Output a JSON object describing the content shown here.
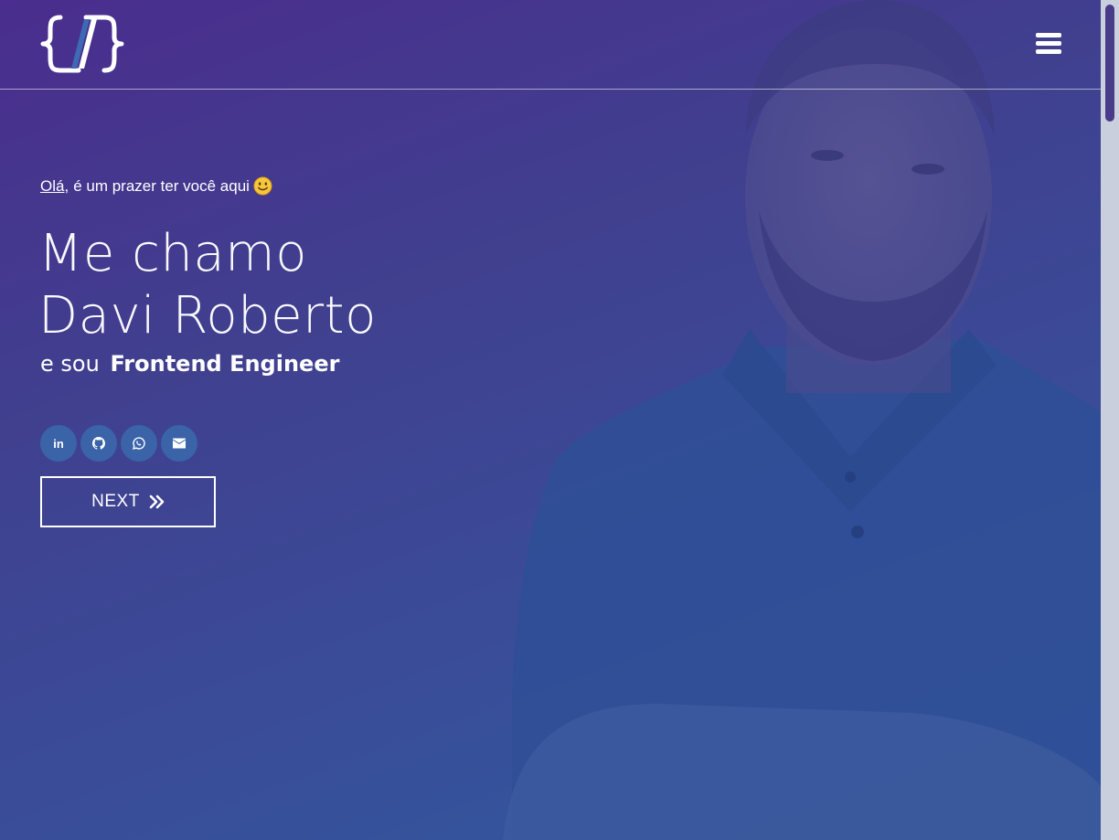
{
  "header": {
    "logo_name": "code-brackets-logo",
    "menu_icon": "hamburger-menu-icon"
  },
  "hero": {
    "greeting_link": "Olá,",
    "greeting_text": "é um prazer ter você aqui",
    "greeting_emoji": "smiling-face-emoji",
    "title_line1": "Me chamo",
    "title_line2": "Davi Roberto",
    "subtitle_prefix": "e sou",
    "subtitle_role": "Frontend Engineer",
    "socials": [
      {
        "name": "linkedin",
        "glyph": "in"
      },
      {
        "name": "github",
        "glyph": "⌥"
      },
      {
        "name": "whatsapp",
        "glyph": "✆"
      },
      {
        "name": "email",
        "glyph": "✉"
      }
    ],
    "next_label": "NEXT"
  },
  "colors": {
    "gradient_start": "#4a2d8e",
    "gradient_end": "#2f5aa0",
    "social_bg": "#3a63a8",
    "scroll_thumb": "#4a3b8a"
  }
}
